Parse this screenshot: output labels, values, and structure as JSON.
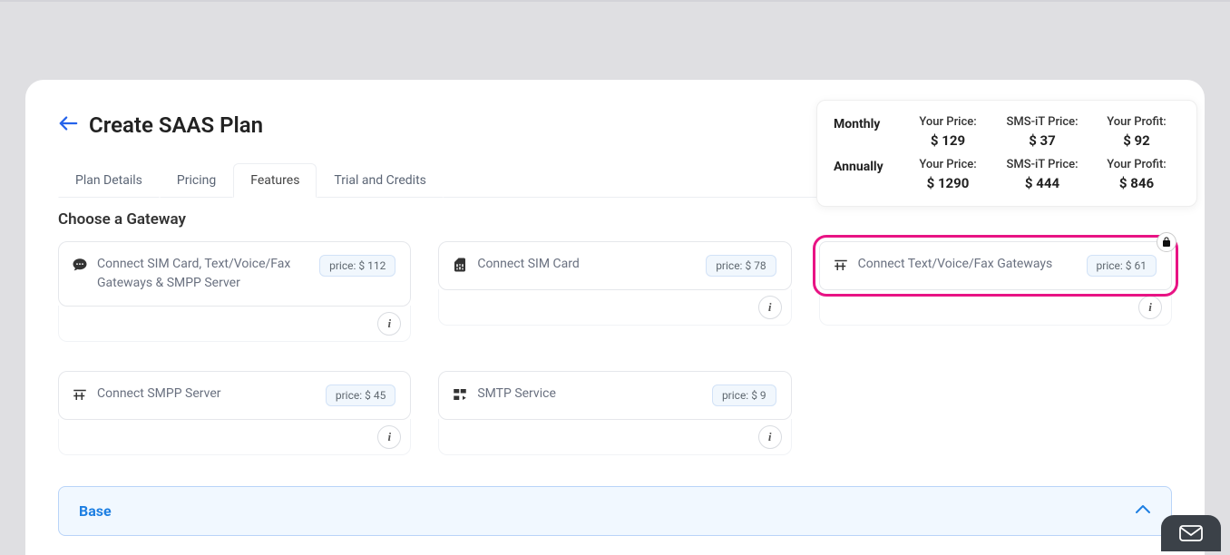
{
  "page": {
    "title": "Create SAAS Plan",
    "section_heading": "Choose a Gateway"
  },
  "tabs": {
    "plan_details": "Plan Details",
    "pricing": "Pricing",
    "features": "Features",
    "trial": "Trial and Credits"
  },
  "gateways": {
    "g0": {
      "label": "Connect SIM Card, Text/Voice/Fax Gateways & SMPP Server",
      "price": "price: $ 112"
    },
    "g1": {
      "label": "Connect SIM Card",
      "price": "price: $ 78"
    },
    "g2": {
      "label": "Connect Text/Voice/Fax Gateways",
      "price": "price: $ 61"
    },
    "g3": {
      "label": "Connect SMPP Server",
      "price": "price: $ 45"
    },
    "g4": {
      "label": "SMTP Service",
      "price": "price: $ 9"
    }
  },
  "pricing_box": {
    "monthly": {
      "period": "Monthly",
      "your_price_label": "Your Price:",
      "your_price_value": "$ 129",
      "smsit_label": "SMS-iT Price:",
      "smsit_value": "$ 37",
      "profit_label": "Your Profit:",
      "profit_value": "$ 92"
    },
    "annually": {
      "period": "Annually",
      "your_price_label": "Your Price:",
      "your_price_value": "$ 1290",
      "smsit_label": "SMS-iT Price:",
      "smsit_value": "$ 444",
      "profit_label": "Your Profit:",
      "profit_value": "$ 846"
    }
  },
  "accordion": {
    "base": "Base"
  }
}
